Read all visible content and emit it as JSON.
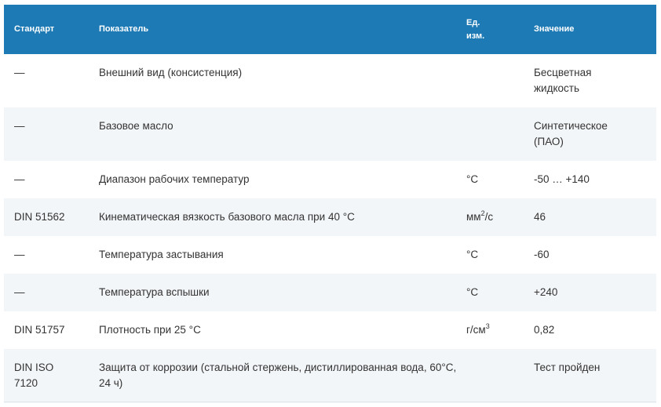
{
  "table": {
    "headers": {
      "standard": "Стандарт",
      "parameter": "Показатель",
      "unit": "Ед. изм.",
      "value": "Значение"
    },
    "rows": [
      {
        "standard": "—",
        "parameter": "Внешний вид (консистенция)",
        "unit_base": "",
        "unit_sup": "",
        "unit_tail": "",
        "value": "Бесцветная жидкость"
      },
      {
        "standard": "—",
        "parameter": "Базовое масло",
        "unit_base": "",
        "unit_sup": "",
        "unit_tail": "",
        "value": "Синтетическое (ПАО)"
      },
      {
        "standard": "—",
        "parameter": "Диапазон рабочих температур",
        "unit_base": "°C",
        "unit_sup": "",
        "unit_tail": "",
        "value": "-50 … +140"
      },
      {
        "standard": "DIN 51562",
        "parameter": "Кинематическая вязкость базового масла при 40 °C",
        "unit_base": "мм",
        "unit_sup": "2",
        "unit_tail": "/с",
        "value": "46"
      },
      {
        "standard": "—",
        "parameter": "Температура застывания",
        "unit_base": "°C",
        "unit_sup": "",
        "unit_tail": "",
        "value": "-60"
      },
      {
        "standard": "—",
        "parameter": "Температура вспышки",
        "unit_base": "°C",
        "unit_sup": "",
        "unit_tail": "",
        "value": "+240"
      },
      {
        "standard": "DIN 51757",
        "parameter": "Плотность при 25 °C",
        "unit_base": "г/см",
        "unit_sup": "3",
        "unit_tail": "",
        "value": "0,82"
      },
      {
        "standard": "DIN ISO 7120",
        "parameter": "Защита от коррозии (стальной стержень, дистиллированная вода, 60°C, 24 ч)",
        "unit_base": "",
        "unit_sup": "",
        "unit_tail": "",
        "value": "Тест пройден"
      }
    ]
  },
  "colors": {
    "header_bg": "#1d7ab5",
    "header_text": "#ffffff",
    "row_alt_bg": "#f3f6f8",
    "body_text": "#333333"
  }
}
